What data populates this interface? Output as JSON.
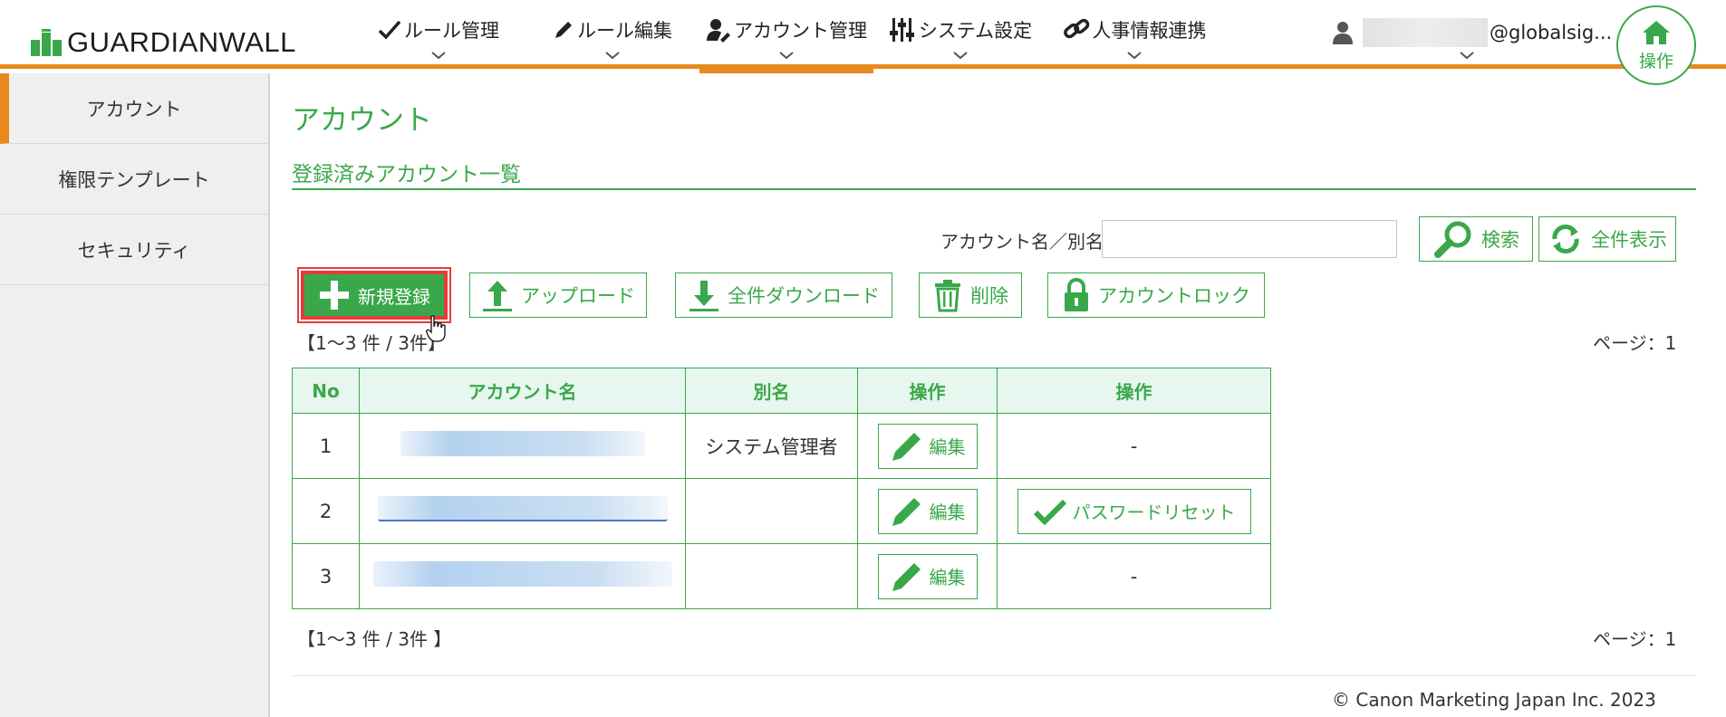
{
  "app": {
    "logo_text": "GUARDIANWALL"
  },
  "nav": [
    {
      "label": "ルール管理",
      "icon": "check-icon"
    },
    {
      "label": "ルール編集",
      "icon": "pencil-icon"
    },
    {
      "label": "アカウント管理",
      "icon": "user-wrench-icon",
      "active": true
    },
    {
      "label": "システム設定",
      "icon": "sliders-icon"
    },
    {
      "label": "人事情報連携",
      "icon": "link-icon"
    }
  ],
  "user": {
    "email_suffix": "@globalsig..."
  },
  "home": {
    "label": "操作"
  },
  "sidebar": {
    "items": [
      {
        "label": "アカウント",
        "active": true
      },
      {
        "label": "権限テンプレート"
      },
      {
        "label": "セキュリティ"
      }
    ]
  },
  "main": {
    "page_title": "アカウント",
    "section_title": "登録済みアカウント一覧",
    "search": {
      "label": "アカウント名／別名",
      "value": "",
      "placeholder": ""
    },
    "buttons": {
      "search": "検索",
      "show_all": "全件表示",
      "new": "新規登録",
      "upload": "アップロード",
      "download_all": "全件ダウンロード",
      "delete": "削除",
      "lock": "アカウントロック"
    },
    "count_top": "【1～3 件 / 3件】",
    "count_bottom": "【1～3 件 / 3件 】",
    "page_top": "ページ：1",
    "page_bottom": "ページ：1",
    "table": {
      "headers": [
        "No",
        "アカウント名",
        "別名",
        "操作",
        "操作"
      ],
      "rows": [
        {
          "no": "1",
          "alias": "システム管理者",
          "edit": "編集",
          "extra": "-"
        },
        {
          "no": "2",
          "alias": "",
          "edit": "編集",
          "extra": "パスワードリセット"
        },
        {
          "no": "3",
          "alias": "",
          "edit": "編集",
          "extra": "-"
        }
      ]
    }
  },
  "footer": {
    "copyright": "© Canon Marketing Japan Inc. 2023"
  },
  "colors": {
    "accent_green": "#3aa84a",
    "accent_orange": "#e8891d",
    "highlight_red": "#e63b3b"
  }
}
